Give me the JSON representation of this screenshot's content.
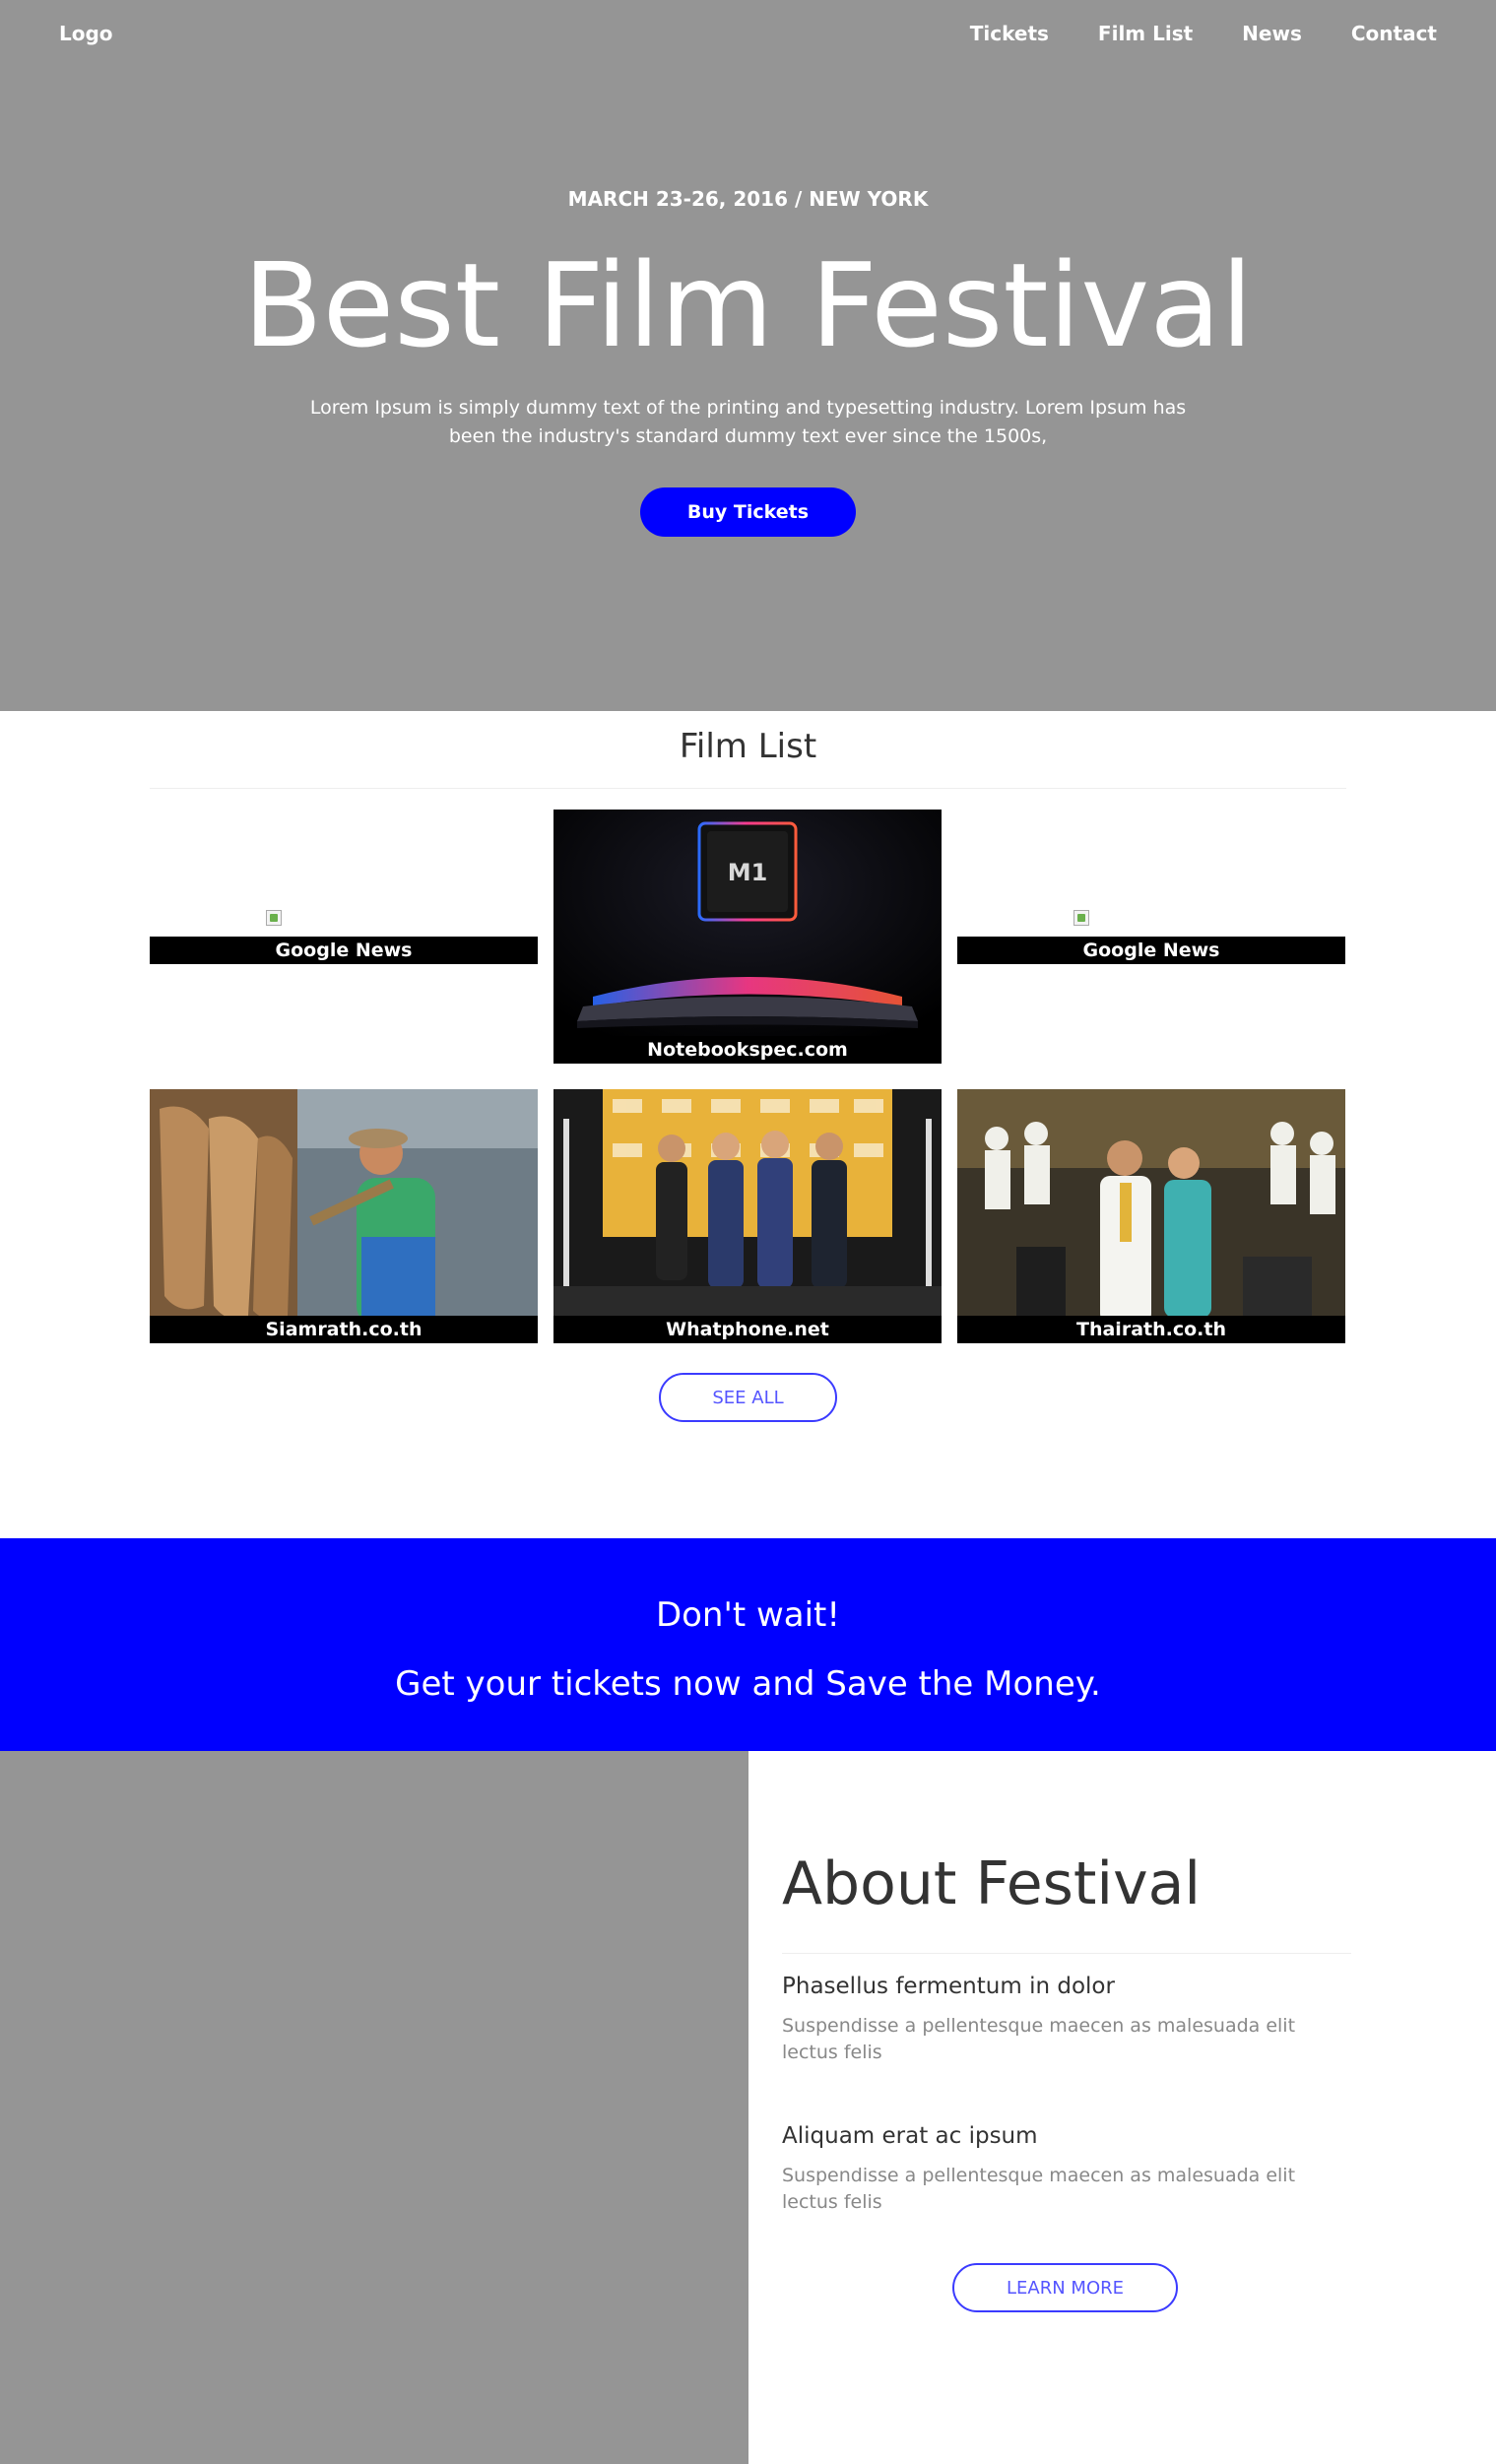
{
  "nav": {
    "logo": "Logo",
    "links": [
      "Tickets",
      "Film List",
      "News",
      "Contact"
    ]
  },
  "hero": {
    "date": "MARCH 23-26, 2016 / NEW YORK",
    "title": "Best Film Festival",
    "description": "Lorem Ipsum is simply dummy text of the printing and typesetting industry. Lorem Ipsum has been the industry's standard dummy text ever since the 1500s,",
    "button": "Buy Tickets"
  },
  "film_list": {
    "title": "Film List",
    "cards": [
      {
        "caption": "Google News",
        "image": "broken-image"
      },
      {
        "caption": "Notebookspec.com",
        "image": "m1-laptop-photo",
        "chip_label": "M1"
      },
      {
        "caption": "Google News",
        "image": "broken-image"
      },
      {
        "caption": "Siamrath.co.th",
        "image": "worker-photo"
      },
      {
        "caption": "Whatphone.net",
        "image": "event-people-photo"
      },
      {
        "caption": "Thairath.co.th",
        "image": "ceremony-photo"
      }
    ],
    "see_all": "SEE ALL"
  },
  "cta": {
    "line1": "Don't wait!",
    "line2": "Get your tickets now and Save the Money."
  },
  "about": {
    "title": "About Festival",
    "items": [
      {
        "heading": "Phasellus fermentum in dolor",
        "text": "Suspendisse a pellentesque maecen as malesuada elit lectus felis"
      },
      {
        "heading": "Aliquam erat ac ipsum",
        "text": "Suspendisse a pellentesque maecen as malesuada elit lectus felis"
      }
    ],
    "button": "LEARN MORE"
  },
  "colors": {
    "hero_bg": "#959595",
    "accent": "#0000ff",
    "outline_button": "#3b3bff"
  }
}
